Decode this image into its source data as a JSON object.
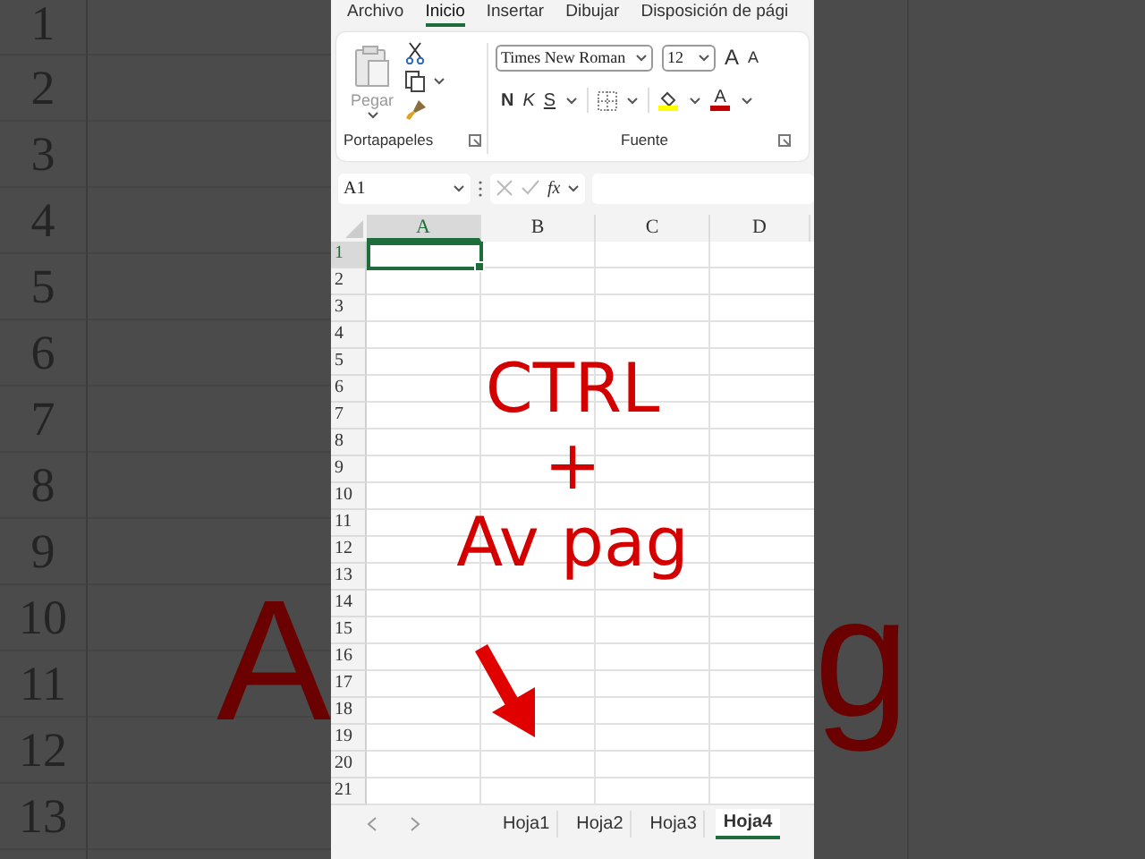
{
  "backdrop": {
    "row_numbers": [
      "1",
      "2",
      "3",
      "4",
      "5",
      "6",
      "7",
      "8",
      "9",
      "10",
      "11",
      "12",
      "13"
    ],
    "fragments": [
      "A",
      "g"
    ]
  },
  "ribbon_tabs": [
    {
      "label": "Archivo",
      "selected": false
    },
    {
      "label": "Inicio",
      "selected": true
    },
    {
      "label": "Insertar",
      "selected": false
    },
    {
      "label": "Dibujar",
      "selected": false
    },
    {
      "label": "Disposición de pági",
      "selected": false
    }
  ],
  "ribbon": {
    "clipboard": {
      "paste_label": "Pegar",
      "group_label": "Portapapeles"
    },
    "font": {
      "font_name": "Times New Roman",
      "font_size": "12",
      "group_label": "Fuente",
      "buttons": [
        {
          "kind": "grow",
          "label": "A"
        },
        {
          "kind": "shrink",
          "label": "A"
        },
        {
          "kind": "bold",
          "label": "N"
        },
        {
          "kind": "italic",
          "label": "K"
        },
        {
          "kind": "underline",
          "label": "S"
        },
        {
          "kind": "borders"
        },
        {
          "kind": "fill",
          "color": "#ffff00"
        },
        {
          "kind": "font_color",
          "label": "A",
          "color": "#c00000"
        }
      ]
    }
  },
  "formula_bar": {
    "name_box": "A1",
    "fx": "fx"
  },
  "sheet": {
    "columns": [
      {
        "label": "A",
        "selected": true
      },
      {
        "label": "B",
        "selected": false
      },
      {
        "label": "C",
        "selected": false
      },
      {
        "label": "D",
        "selected": false
      }
    ],
    "rows": [
      {
        "label": "1",
        "selected": true
      },
      {
        "label": "2",
        "selected": false
      },
      {
        "label": "3",
        "selected": false
      },
      {
        "label": "4",
        "selected": false
      },
      {
        "label": "5",
        "selected": false
      },
      {
        "label": "6",
        "selected": false
      },
      {
        "label": "7",
        "selected": false
      },
      {
        "label": "8",
        "selected": false
      },
      {
        "label": "9",
        "selected": false
      },
      {
        "label": "10",
        "selected": false
      },
      {
        "label": "11",
        "selected": false
      },
      {
        "label": "12",
        "selected": false
      },
      {
        "label": "13",
        "selected": false
      },
      {
        "label": "14",
        "selected": false
      },
      {
        "label": "15",
        "selected": false
      },
      {
        "label": "16",
        "selected": false
      },
      {
        "label": "17",
        "selected": false
      },
      {
        "label": "18",
        "selected": false
      },
      {
        "label": "19",
        "selected": false
      },
      {
        "label": "20",
        "selected": false
      },
      {
        "label": "21",
        "selected": false
      }
    ]
  },
  "sheet_tabs": [
    {
      "label": "Hoja1",
      "selected": false
    },
    {
      "label": "Hoja2",
      "selected": false
    },
    {
      "label": "Hoja3",
      "selected": false
    },
    {
      "label": "Hoja4",
      "selected": true
    }
  ],
  "overlay": {
    "lines": [
      "CTRL",
      "+",
      "Av pag"
    ]
  }
}
